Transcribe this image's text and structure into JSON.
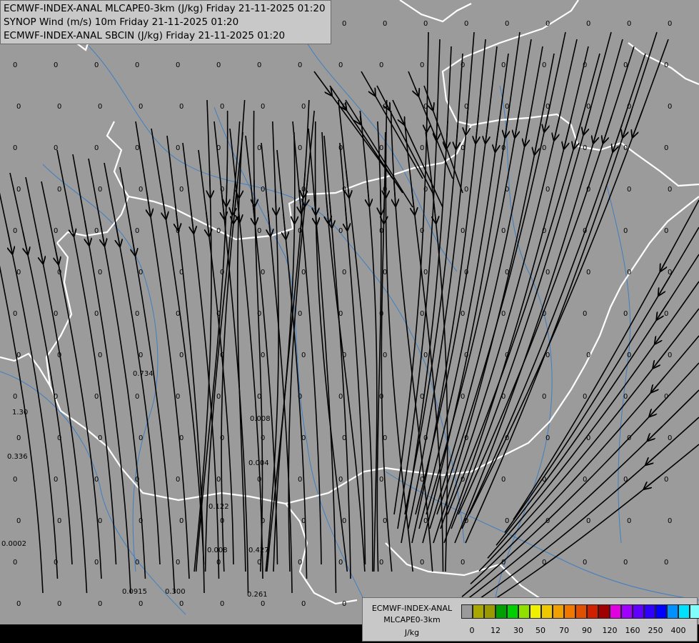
{
  "titles": [
    "ECMWF-INDEX-ANAL MLCAPE0-3km (J/kg) Friday 21-11-2025 01:20",
    "SYNOP Wind (m/s) 10m Friday 21-11-2025 01:20",
    "ECMWF-INDEX-ANAL SBCIN (J/kg) Friday 21-11-2025 01:20"
  ],
  "legend": {
    "title_line1": "ECMWF-INDEX-ANAL",
    "title_line2": "MLCAPE0-3km",
    "unit": "J/kg",
    "colors": [
      "#9a9a9a",
      "#a8a800",
      "#9a9a00",
      "#00a000",
      "#00d000",
      "#90e000",
      "#f0f000",
      "#f0c800",
      "#f0a000",
      "#f07800",
      "#e05000",
      "#d02000",
      "#a00000",
      "#e000e0",
      "#a000ff",
      "#6000ff",
      "#3000ff",
      "#0000ff",
      "#0090ff",
      "#00e0ff",
      "#80ffff",
      "#ffffff"
    ],
    "tick_labels": [
      "0",
      "12",
      "30",
      "50",
      "70",
      "90",
      "120",
      "160",
      "250",
      "400"
    ]
  },
  "value_labels": {
    "plain": "0",
    "special": [
      "0.734",
      "1.30",
      "0.336",
      "0.0002",
      "0.008",
      "0.004",
      "0.122",
      "0.008",
      "0.427",
      "0.0915",
      "0.300",
      "0.261"
    ]
  },
  "colors": {
    "background": "#9b9b9b",
    "border": "#ffffff",
    "river": "#3f7fc0",
    "streamline": "#000000"
  }
}
